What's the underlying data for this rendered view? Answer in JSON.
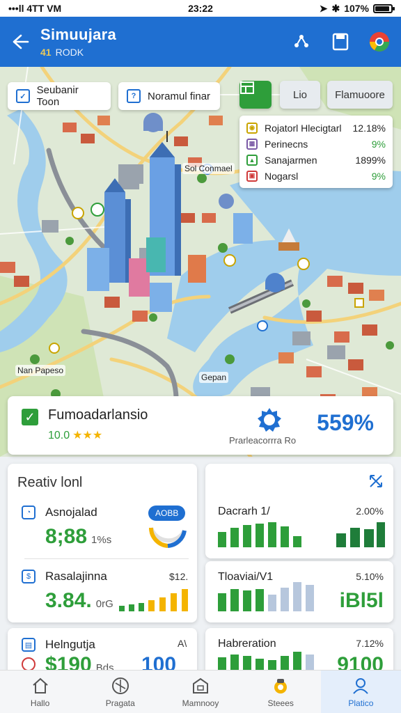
{
  "status_bar": {
    "carrier": "•••ll 4TT VM",
    "time": "23:22",
    "battery": "107%"
  },
  "header": {
    "title": "Simuujara",
    "subtitle": "RODK",
    "subtitle_prefix": "41"
  },
  "map": {
    "chips": [
      {
        "label": "Seubanir Toon"
      },
      {
        "label": "Noramul finar"
      }
    ],
    "buttons": {
      "primary": "",
      "second": "Lio",
      "third": "Flamuoore"
    },
    "legend": [
      {
        "label": "Rojatorl Hlecigtarl",
        "value": "12.18%",
        "color": "#c9a400"
      },
      {
        "label": "Perinecns",
        "value": "9%",
        "color": "#7b5aa6"
      },
      {
        "label": "Sanajarmen",
        "value": "1899%",
        "color": "#2e9e3a"
      },
      {
        "label": "Nogarsl",
        "value": "9%",
        "color": "#d03a3a"
      }
    ],
    "labels": [
      {
        "text": "Sol Conmael"
      },
      {
        "text": "Nan Papeso"
      },
      {
        "text": "Gepan"
      }
    ]
  },
  "summary": {
    "name": "Fumoadarlansio",
    "rating_value": "10.0",
    "stars": "★★★",
    "gear_label": "Prarleacorrra Ro",
    "percent": "559%"
  },
  "left_panel": {
    "title": "Reativ lonl",
    "stats": [
      {
        "label": "Asnojalad",
        "big": "8;88",
        "unit": "1%s",
        "pill": "AOBB"
      },
      {
        "label": "Rasalajinna",
        "big": "3.84.",
        "unit": "0rG",
        "right": "$12."
      },
      {
        "label": "Helngutja",
        "big": "$190",
        "unit": "Bds",
        "right": "A\\",
        "extra": "100"
      }
    ]
  },
  "right_panel": {
    "stats": [
      {
        "label": "Dacrarh 1/",
        "value": "2.00%"
      },
      {
        "label": "Tloaviai/V1",
        "value": "5.10%",
        "big": "iBl5l"
      },
      {
        "label": "Habreration",
        "value": "7.12%",
        "big": "9100"
      }
    ]
  },
  "nav": [
    {
      "label": "Hallo",
      "icon": "home-icon"
    },
    {
      "label": "Pragata",
      "icon": "compass-icon"
    },
    {
      "label": "Mamnooy",
      "icon": "building-icon"
    },
    {
      "label": "Steees",
      "icon": "stats-icon"
    },
    {
      "label": "Platico",
      "icon": "profile-icon"
    }
  ],
  "colors": {
    "brand": "#1f6fd1",
    "green": "#2e9e3a",
    "water": "#9fcdec",
    "amber": "#f4b400"
  }
}
